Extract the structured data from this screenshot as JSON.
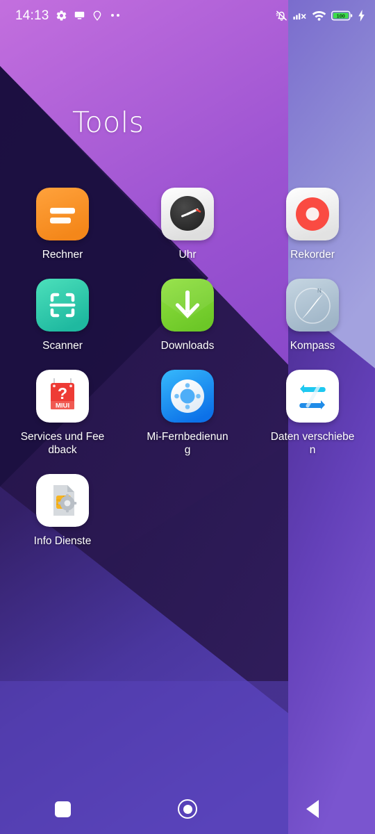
{
  "status_bar": {
    "time": "14:13",
    "left_icons": [
      {
        "name": "gear-icon",
        "label": "Settings"
      },
      {
        "name": "cast-screen-icon",
        "label": "Screen cast"
      },
      {
        "name": "location-pin-icon",
        "label": "Location"
      },
      {
        "name": "more-dots-icon",
        "label": "More notifications"
      }
    ],
    "right_icons": [
      {
        "name": "mute-bell-icon",
        "label": "Silent mode"
      },
      {
        "name": "signal-no-sim-icon",
        "label": "No SIM"
      },
      {
        "name": "wifi-icon",
        "label": "Wi-Fi connected"
      },
      {
        "name": "battery-icon",
        "label": "Battery"
      },
      {
        "name": "charging-bolt-icon",
        "label": "Charging"
      }
    ],
    "battery_level": "100",
    "battery_color": "#3ddc4b"
  },
  "folder": {
    "title": "Tools"
  },
  "apps": [
    {
      "id": "rechner",
      "label": "Rechner",
      "icon": "calculator-icon",
      "color": "#f79222"
    },
    {
      "id": "uhr",
      "label": "Uhr",
      "icon": "clock-icon",
      "color": "#f2f2f2"
    },
    {
      "id": "rekorder",
      "label": "Rekorder",
      "icon": "recorder-icon",
      "color": "#ffffff"
    },
    {
      "id": "scanner",
      "label": "Scanner",
      "icon": "scanner-icon",
      "color": "#2fd0ae"
    },
    {
      "id": "downloads",
      "label": "Downloads",
      "icon": "download-icon",
      "color": "#7bd830"
    },
    {
      "id": "kompass",
      "label": "Kompass",
      "icon": "compass-icon",
      "color": "#b6c7d6"
    },
    {
      "id": "services",
      "label": "Services und Feedback",
      "icon": "miui-help-icon",
      "color": "#ffffff"
    },
    {
      "id": "fernbedienung",
      "label": "Mi-Fernbedienung",
      "icon": "remote-icon",
      "color": "#1e9bf5"
    },
    {
      "id": "mover",
      "label": "Daten verschieben",
      "icon": "mi-mover-icon",
      "color": "#ffffff"
    },
    {
      "id": "infodienste",
      "label": "Info Dienste",
      "icon": "sim-settings-icon",
      "color": "#ffffff"
    }
  ],
  "nav_bar": {
    "recents_label": "Recents",
    "home_label": "Home",
    "back_label": "Back"
  },
  "wallpaper": {
    "top_purple": "#b05fd4",
    "mid_purple": "#7b3fc4",
    "dark_navy": "#241449",
    "right_light": "#9b9ad8",
    "bottom_purple": "#5d45bd"
  }
}
